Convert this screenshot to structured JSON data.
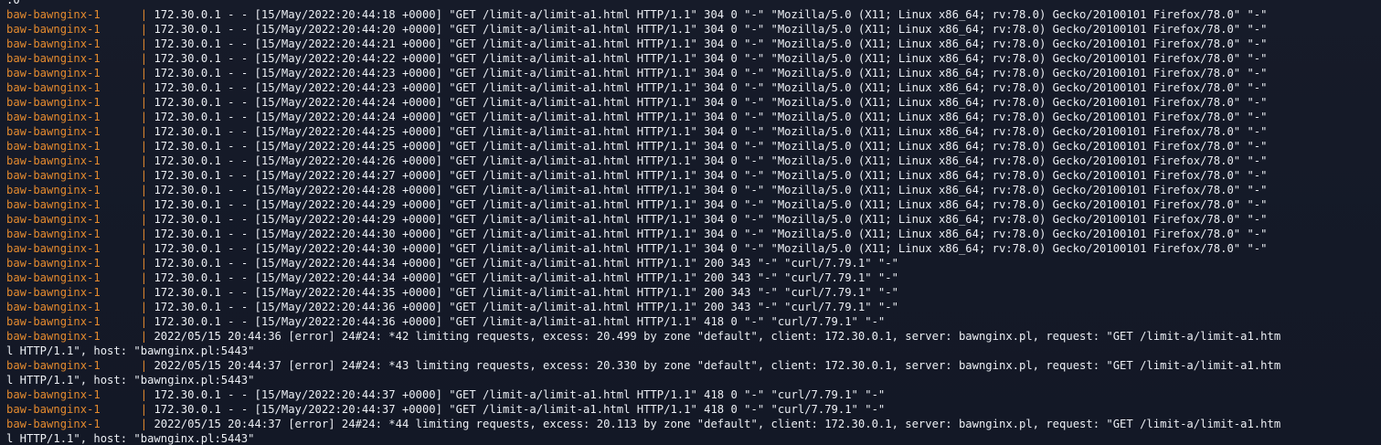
{
  "terminal": {
    "top_fragment": ".0",
    "service": "baw-bawnginx-1",
    "separator": "|",
    "entries": [
      {
        "message": "172.30.0.1 - - [15/May/2022:20:44:18 +0000] \"GET /limit-a/limit-a1.html HTTP/1.1\" 304 0 \"-\" \"Mozilla/5.0 (X11; Linux x86_64; rv:78.0) Gecko/20100101 Firefox/78.0\" \"-\""
      },
      {
        "message": "172.30.0.1 - - [15/May/2022:20:44:20 +0000] \"GET /limit-a/limit-a1.html HTTP/1.1\" 304 0 \"-\" \"Mozilla/5.0 (X11; Linux x86_64; rv:78.0) Gecko/20100101 Firefox/78.0\" \"-\""
      },
      {
        "message": "172.30.0.1 - - [15/May/2022:20:44:21 +0000] \"GET /limit-a/limit-a1.html HTTP/1.1\" 304 0 \"-\" \"Mozilla/5.0 (X11; Linux x86_64; rv:78.0) Gecko/20100101 Firefox/78.0\" \"-\""
      },
      {
        "message": "172.30.0.1 - - [15/May/2022:20:44:22 +0000] \"GET /limit-a/limit-a1.html HTTP/1.1\" 304 0 \"-\" \"Mozilla/5.0 (X11; Linux x86_64; rv:78.0) Gecko/20100101 Firefox/78.0\" \"-\""
      },
      {
        "message": "172.30.0.1 - - [15/May/2022:20:44:23 +0000] \"GET /limit-a/limit-a1.html HTTP/1.1\" 304 0 \"-\" \"Mozilla/5.0 (X11; Linux x86_64; rv:78.0) Gecko/20100101 Firefox/78.0\" \"-\""
      },
      {
        "message": "172.30.0.1 - - [15/May/2022:20:44:23 +0000] \"GET /limit-a/limit-a1.html HTTP/1.1\" 304 0 \"-\" \"Mozilla/5.0 (X11; Linux x86_64; rv:78.0) Gecko/20100101 Firefox/78.0\" \"-\""
      },
      {
        "message": "172.30.0.1 - - [15/May/2022:20:44:24 +0000] \"GET /limit-a/limit-a1.html HTTP/1.1\" 304 0 \"-\" \"Mozilla/5.0 (X11; Linux x86_64; rv:78.0) Gecko/20100101 Firefox/78.0\" \"-\""
      },
      {
        "message": "172.30.0.1 - - [15/May/2022:20:44:24 +0000] \"GET /limit-a/limit-a1.html HTTP/1.1\" 304 0 \"-\" \"Mozilla/5.0 (X11; Linux x86_64; rv:78.0) Gecko/20100101 Firefox/78.0\" \"-\""
      },
      {
        "message": "172.30.0.1 - - [15/May/2022:20:44:25 +0000] \"GET /limit-a/limit-a1.html HTTP/1.1\" 304 0 \"-\" \"Mozilla/5.0 (X11; Linux x86_64; rv:78.0) Gecko/20100101 Firefox/78.0\" \"-\""
      },
      {
        "message": "172.30.0.1 - - [15/May/2022:20:44:25 +0000] \"GET /limit-a/limit-a1.html HTTP/1.1\" 304 0 \"-\" \"Mozilla/5.0 (X11; Linux x86_64; rv:78.0) Gecko/20100101 Firefox/78.0\" \"-\""
      },
      {
        "message": "172.30.0.1 - - [15/May/2022:20:44:26 +0000] \"GET /limit-a/limit-a1.html HTTP/1.1\" 304 0 \"-\" \"Mozilla/5.0 (X11; Linux x86_64; rv:78.0) Gecko/20100101 Firefox/78.0\" \"-\""
      },
      {
        "message": "172.30.0.1 - - [15/May/2022:20:44:27 +0000] \"GET /limit-a/limit-a1.html HTTP/1.1\" 304 0 \"-\" \"Mozilla/5.0 (X11; Linux x86_64; rv:78.0) Gecko/20100101 Firefox/78.0\" \"-\""
      },
      {
        "message": "172.30.0.1 - - [15/May/2022:20:44:28 +0000] \"GET /limit-a/limit-a1.html HTTP/1.1\" 304 0 \"-\" \"Mozilla/5.0 (X11; Linux x86_64; rv:78.0) Gecko/20100101 Firefox/78.0\" \"-\""
      },
      {
        "message": "172.30.0.1 - - [15/May/2022:20:44:29 +0000] \"GET /limit-a/limit-a1.html HTTP/1.1\" 304 0 \"-\" \"Mozilla/5.0 (X11; Linux x86_64; rv:78.0) Gecko/20100101 Firefox/78.0\" \"-\""
      },
      {
        "message": "172.30.0.1 - - [15/May/2022:20:44:29 +0000] \"GET /limit-a/limit-a1.html HTTP/1.1\" 304 0 \"-\" \"Mozilla/5.0 (X11; Linux x86_64; rv:78.0) Gecko/20100101 Firefox/78.0\" \"-\""
      },
      {
        "message": "172.30.0.1 - - [15/May/2022:20:44:30 +0000] \"GET /limit-a/limit-a1.html HTTP/1.1\" 304 0 \"-\" \"Mozilla/5.0 (X11; Linux x86_64; rv:78.0) Gecko/20100101 Firefox/78.0\" \"-\""
      },
      {
        "message": "172.30.0.1 - - [15/May/2022:20:44:30 +0000] \"GET /limit-a/limit-a1.html HTTP/1.1\" 304 0 \"-\" \"Mozilla/5.0 (X11; Linux x86_64; rv:78.0) Gecko/20100101 Firefox/78.0\" \"-\""
      },
      {
        "message": "172.30.0.1 - - [15/May/2022:20:44:34 +0000] \"GET /limit-a/limit-a1.html HTTP/1.1\" 200 343 \"-\" \"curl/7.79.1\" \"-\""
      },
      {
        "message": "172.30.0.1 - - [15/May/2022:20:44:34 +0000] \"GET /limit-a/limit-a1.html HTTP/1.1\" 200 343 \"-\" \"curl/7.79.1\" \"-\""
      },
      {
        "message": "172.30.0.1 - - [15/May/2022:20:44:35 +0000] \"GET /limit-a/limit-a1.html HTTP/1.1\" 200 343 \"-\" \"curl/7.79.1\" \"-\""
      },
      {
        "message": "172.30.0.1 - - [15/May/2022:20:44:36 +0000] \"GET /limit-a/limit-a1.html HTTP/1.1\" 200 343 \"-\" \"curl/7.79.1\" \"-\""
      },
      {
        "message": "172.30.0.1 - - [15/May/2022:20:44:36 +0000] \"GET /limit-a/limit-a1.html HTTP/1.1\" 418 0 \"-\" \"curl/7.79.1\" \"-\""
      },
      {
        "message": "2022/05/15 20:44:36 [error] 24#24: *42 limiting requests, excess: 20.499 by zone \"default\", client: 172.30.0.1, server: bawnginx.pl, request: \"GET /limit-a/limit-a1.htm",
        "continuation": "l HTTP/1.1\", host: \"bawnginx.pl:5443\""
      },
      {
        "message": "2022/05/15 20:44:37 [error] 24#24: *43 limiting requests, excess: 20.330 by zone \"default\", client: 172.30.0.1, server: bawnginx.pl, request: \"GET /limit-a/limit-a1.htm",
        "continuation": "l HTTP/1.1\", host: \"bawnginx.pl:5443\""
      },
      {
        "message": "172.30.0.1 - - [15/May/2022:20:44:37 +0000] \"GET /limit-a/limit-a1.html HTTP/1.1\" 418 0 \"-\" \"curl/7.79.1\" \"-\""
      },
      {
        "message": "172.30.0.1 - - [15/May/2022:20:44:37 +0000] \"GET /limit-a/limit-a1.html HTTP/1.1\" 418 0 \"-\" \"curl/7.79.1\" \"-\""
      },
      {
        "message": "2022/05/15 20:44:37 [error] 24#24: *44 limiting requests, excess: 20.113 by zone \"default\", client: 172.30.0.1, server: bawnginx.pl, request: \"GET /limit-a/limit-a1.htm",
        "continuation": "l HTTP/1.1\", host: \"bawnginx.pl:5443\""
      }
    ]
  },
  "colors": {
    "background": "#151a27",
    "service_name": "#e48a2e",
    "text": "#eceff4"
  }
}
